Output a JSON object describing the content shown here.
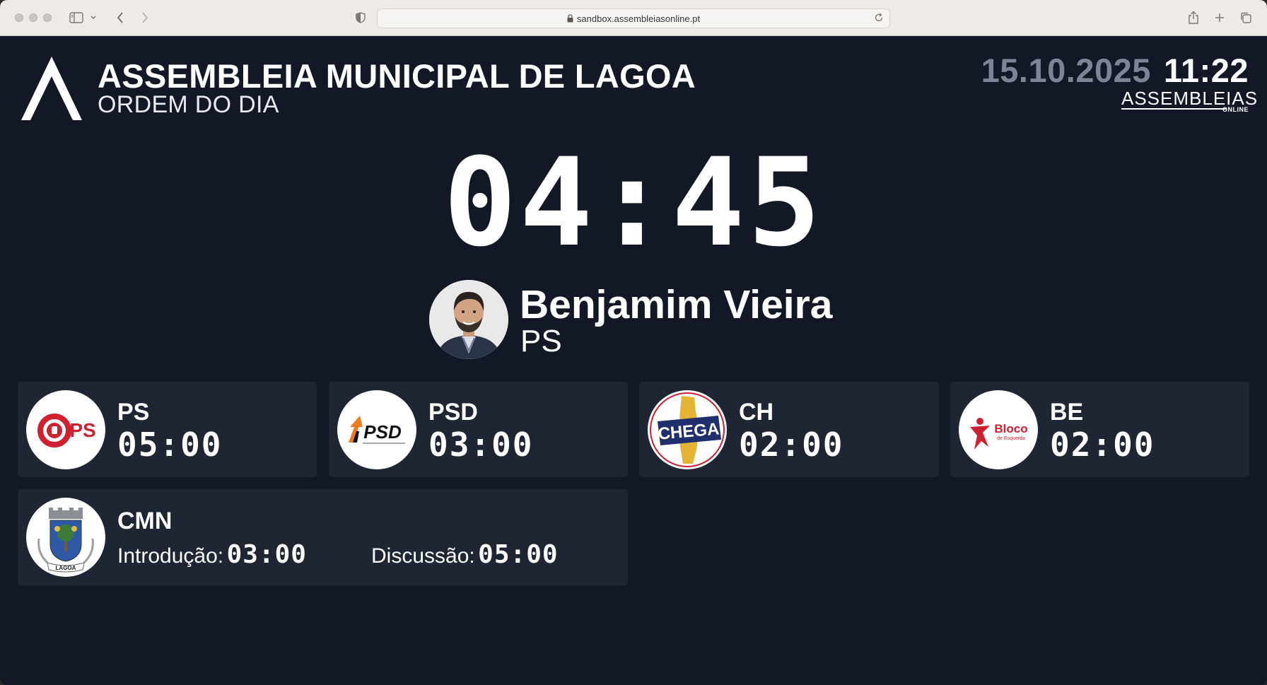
{
  "browser": {
    "url": "sandbox.assembleiasonline.pt"
  },
  "header": {
    "title": "ASSEMBLEIA MUNICIPAL DE LAGOA",
    "subtitle": "ORDEM DO DIA",
    "date": "15.10.2025",
    "time": "11:22",
    "brand": "ASSEMBLEIAS",
    "brand_sub": "ONLINE"
  },
  "timer": "04:45",
  "speaker": {
    "name": "Benjamim Vieira",
    "party": "PS"
  },
  "parties": [
    {
      "name": "PS",
      "time": "05:00",
      "logo_text": "PS",
      "logo_color": "#d0202f"
    },
    {
      "name": "PSD",
      "time": "03:00",
      "logo_text": "PSD",
      "logo_color": "#f07c1c"
    },
    {
      "name": "CH",
      "time": "02:00",
      "logo_text": "CHEGA",
      "logo_color": "#1f2f6b"
    },
    {
      "name": "BE",
      "time": "02:00",
      "logo_text": "Bloco",
      "logo_sub": "de Esquerda",
      "logo_color": "#d0202f"
    }
  ],
  "cmn": {
    "name": "CMN",
    "intro_label": "Introdução:",
    "intro_time": "03:00",
    "disc_label": "Discussão:",
    "disc_time": "05:00",
    "logo_text": "LAGOA"
  },
  "colors": {
    "background": "#121826",
    "card": "#1e2533",
    "date": "#7d8594"
  }
}
